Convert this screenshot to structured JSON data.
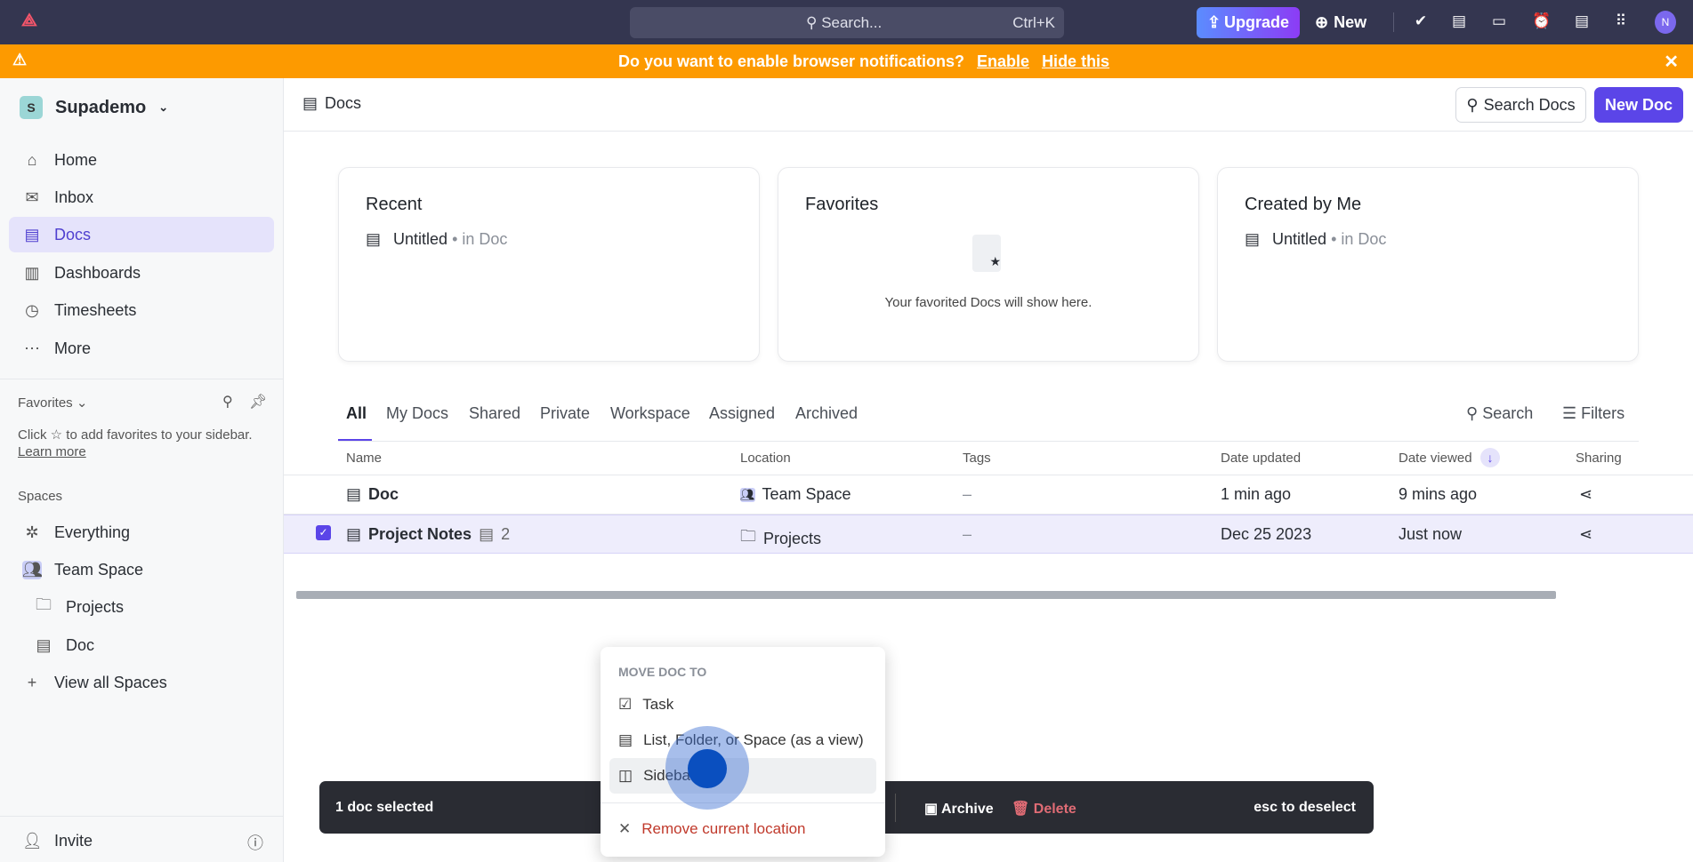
{
  "topbar": {
    "search_placeholder": "Search...",
    "shortcut": "Ctrl+K",
    "upgrade": "Upgrade",
    "new": "New",
    "avatar": "N"
  },
  "banner": {
    "message": "Do you want to enable browser notifications?",
    "enable": "Enable",
    "hide": "Hide this"
  },
  "sidebar": {
    "workspace": "Supademo",
    "workspace_initial": "S",
    "nav": [
      {
        "label": "Home",
        "icon": "⌂"
      },
      {
        "label": "Inbox",
        "icon": "✉"
      },
      {
        "label": "Docs",
        "icon": "▤"
      },
      {
        "label": "Dashboards",
        "icon": "▥"
      },
      {
        "label": "Timesheets",
        "icon": "◷"
      },
      {
        "label": "More",
        "icon": "⋯"
      }
    ],
    "favorites_label": "Favorites",
    "favorites_hint_a": "Click",
    "favorites_hint_b": "to add favorites to your sidebar.",
    "learn_more": "Learn more",
    "spaces_label": "Spaces",
    "spaces": [
      {
        "label": "Everything"
      },
      {
        "label": "Team Space"
      },
      {
        "label": "Projects"
      },
      {
        "label": "Doc"
      },
      {
        "label": "View all Spaces"
      }
    ],
    "invite": "Invite"
  },
  "header": {
    "crumb": "Docs",
    "search_docs": "Search Docs",
    "new_doc": "New Doc"
  },
  "cards": {
    "recent": {
      "title": "Recent",
      "item": "Untitled",
      "loc": "• in Doc"
    },
    "favorites": {
      "title": "Favorites",
      "empty": "Your favorited Docs will show here."
    },
    "created": {
      "title": "Created by Me",
      "item": "Untitled",
      "loc": "• in Doc"
    }
  },
  "tabs": [
    "All",
    "My Docs",
    "Shared",
    "Private",
    "Workspace",
    "Assigned",
    "Archived"
  ],
  "table_actions": {
    "search": "Search",
    "filters": "Filters"
  },
  "columns": [
    "Name",
    "Location",
    "Tags",
    "Date updated",
    "Date viewed",
    "Sharing"
  ],
  "rows": [
    {
      "name": "Doc",
      "subcount": "",
      "location": "Team Space",
      "tags": "–",
      "updated": "1 min ago",
      "viewed": "9 mins ago",
      "selected": false
    },
    {
      "name": "Project Notes",
      "subcount": "2",
      "location": "Projects",
      "tags": "–",
      "updated": "Dec 25 2023",
      "viewed": "Just now",
      "selected": true
    }
  ],
  "bulk": {
    "selected": "1 doc selected",
    "archive": "Archive",
    "delete": "Delete",
    "esc": "esc to deselect"
  },
  "menu": {
    "header": "MOVE DOC TO",
    "items": [
      "Task",
      "List, Folder, or Space (as a view)",
      "Sidebar"
    ],
    "remove": "Remove current location"
  }
}
